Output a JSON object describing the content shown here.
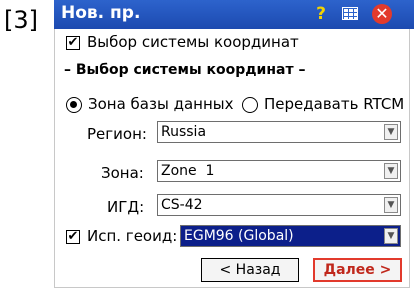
{
  "figure_label": "[3]",
  "window": {
    "title": "Нов. пр.",
    "help_icon": "?",
    "close_icon": "✕"
  },
  "checkbox_select_cs": {
    "label": "Выбор системы координат",
    "checked": true
  },
  "section_heading": "– Выбор системы координат –",
  "radio_options": [
    {
      "label": "Зона базы данных",
      "selected": true
    },
    {
      "label": "Передавать RTCM",
      "selected": false
    }
  ],
  "fields": {
    "region": {
      "label": "Регион:",
      "value": "Russia"
    },
    "zone": {
      "label": "Зона:",
      "value": "Zone  1"
    },
    "datum": {
      "label": "ИГД:",
      "value": "CS-42"
    },
    "geoid": {
      "label": "Исп. геоид:",
      "value": "EGM96 (Global)",
      "checked": true
    }
  },
  "buttons": {
    "back": "< Назад",
    "next": "Далее >"
  },
  "colors": {
    "titlebar": "#1c4ab0",
    "accent_red": "#e23a2c",
    "selection": "#0c1f8a"
  }
}
